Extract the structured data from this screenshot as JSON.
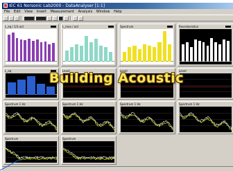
{
  "window": {
    "title": "IEC 61 Norsonic Lab2000 - DataAnalyser [1:1]",
    "menu": [
      "File",
      "Edit",
      "View",
      "Insert",
      "Measurement",
      "Analysis",
      "Window",
      "Help"
    ]
  },
  "overlay": {
    "caption": "Building Acoustic"
  },
  "panels": {
    "p1": {
      "title": "L_eq / 1/3 oct",
      "color": "#8a3fb0",
      "values": [
        0.85,
        0.92,
        0.75,
        0.7,
        0.68,
        0.72,
        0.65,
        0.7,
        0.6,
        0.62,
        0.55,
        0.58
      ]
    },
    "p2": {
      "title": "L_max / oct",
      "color": "#8fd8c8",
      "values": [
        0.35,
        0.45,
        0.55,
        0.5,
        0.8,
        0.6,
        0.72,
        0.5,
        0.45,
        0.3
      ]
    },
    "p3": {
      "title": "Spectrum",
      "color": "#f0e020",
      "values": [
        0.3,
        0.45,
        0.5,
        0.4,
        0.55,
        0.5,
        0.45,
        0.6,
        0.95,
        0.55
      ]
    },
    "p4": {
      "title": "Reverberation",
      "color": "#ffffff",
      "values": [
        0.55,
        0.6,
        0.45,
        0.7,
        0.65,
        0.6,
        0.5,
        0.75,
        0.6,
        0.55,
        0.7,
        0.65
      ]
    },
    "p5": {
      "title": "L_eq",
      "color": "#2a5fd0",
      "values": [
        0.6,
        0.75,
        0.9,
        0.55,
        0.4
      ]
    },
    "p6": {
      "title": "Level"
    },
    "p7": {
      "title": "Level"
    },
    "p8": {
      "title": "Level"
    },
    "p9": {
      "title": "Spectrum 1 Hz"
    },
    "p10": {
      "title": "Spectrum 1 Hz"
    },
    "p11": {
      "title": "Spectrum 1 Hz"
    },
    "p12": {
      "title": "Spectrum 1 Hz"
    },
    "p13": {
      "title": "Spectrum"
    },
    "p14": {
      "title": "Spectrum"
    }
  },
  "status": ""
}
